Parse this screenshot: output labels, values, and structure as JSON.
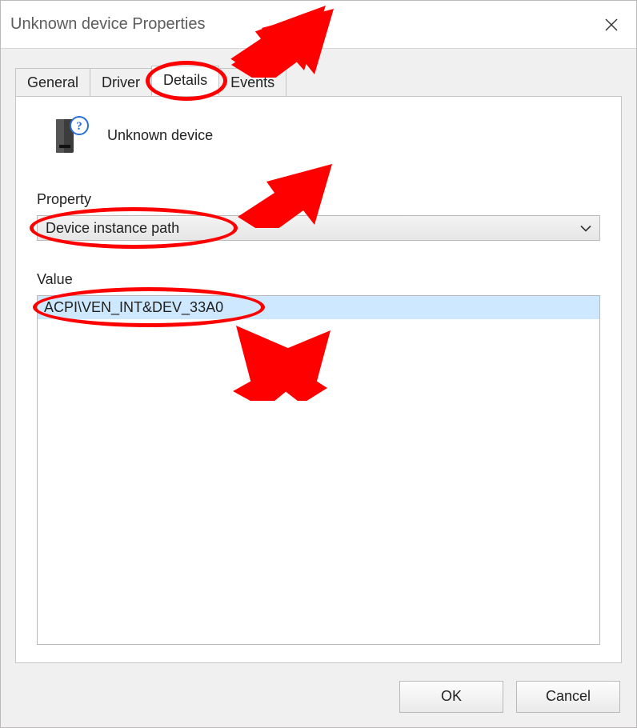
{
  "titlebar": {
    "title": "Unknown device Properties"
  },
  "tabs": {
    "general": "General",
    "driver": "Driver",
    "details": "Details",
    "events": "Events"
  },
  "main": {
    "device_label": "Unknown device",
    "property_section": "Property",
    "property_selected": "Device instance path",
    "value_section": "Value",
    "value_row": "ACPI\\VEN_INT&DEV_33A0"
  },
  "buttons": {
    "ok": "OK",
    "cancel": "Cancel"
  }
}
